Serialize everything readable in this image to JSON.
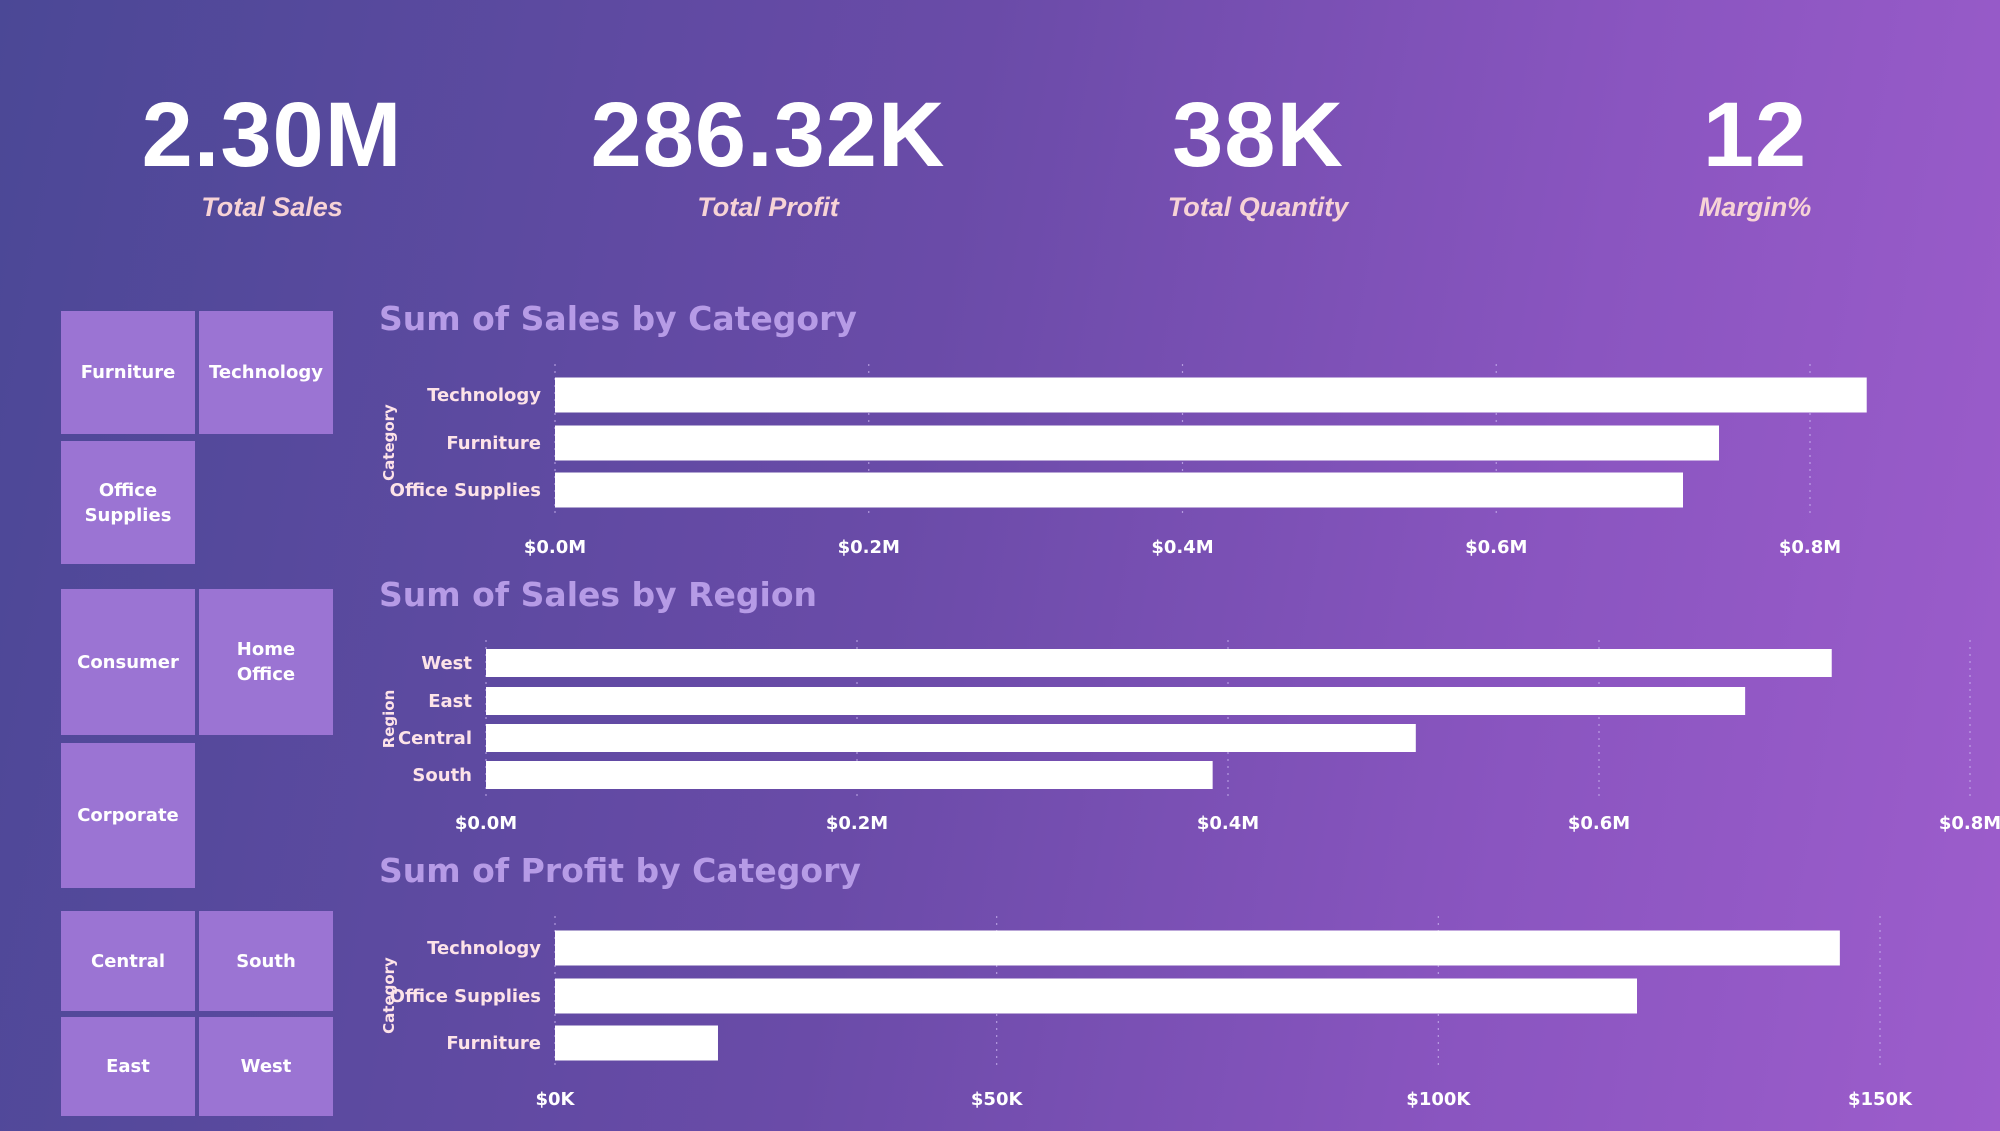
{
  "kpis": [
    {
      "value": "2.30M",
      "label": "Total Sales"
    },
    {
      "value": "286.32K",
      "label": "Total Profit"
    },
    {
      "value": "38K",
      "label": "Total Quantity"
    },
    {
      "value": "12",
      "label": "Margin%"
    }
  ],
  "slicers": {
    "category": [
      "Furniture",
      "Technology",
      "Office Supplies"
    ],
    "segment": [
      "Consumer",
      "Home Office",
      "Corporate"
    ],
    "region": [
      "Central",
      "South",
      "East",
      "West"
    ]
  },
  "colors": {
    "tile": "#9b74d3",
    "bar": "#ffffff",
    "title": "#b69be6",
    "kpi_label": "#f7d3d6"
  },
  "chart_data": [
    {
      "type": "bar",
      "orientation": "horizontal",
      "title": "Sum of Sales by Category",
      "ylabel": "Category",
      "xlabel": "",
      "categories": [
        "Technology",
        "Furniture",
        "Office Supplies"
      ],
      "values": [
        836154,
        741999,
        719047
      ],
      "xlim": [
        0,
        800000
      ],
      "ticks": [
        0,
        200000,
        400000,
        600000,
        800000
      ],
      "tick_labels": [
        "$0.0M",
        "$0.2M",
        "$0.4M",
        "$0.6M",
        "$0.8M"
      ],
      "grid": true
    },
    {
      "type": "bar",
      "orientation": "horizontal",
      "title": "Sum of Sales by Region",
      "ylabel": "Region",
      "xlabel": "",
      "categories": [
        "West",
        "East",
        "Central",
        "South"
      ],
      "values": [
        725458,
        678781,
        501240,
        391722
      ],
      "xlim": [
        0,
        800000
      ],
      "ticks": [
        0,
        200000,
        400000,
        600000,
        800000
      ],
      "tick_labels": [
        "$0.0M",
        "$0.2M",
        "$0.4M",
        "$0.6M",
        "$0.8M"
      ],
      "grid": true
    },
    {
      "type": "bar",
      "orientation": "horizontal",
      "title": "Sum of Profit by Category",
      "ylabel": "Category",
      "xlabel": "",
      "categories": [
        "Technology",
        "Office Supplies",
        "Furniture"
      ],
      "values": [
        145455,
        122491,
        18451
      ],
      "xlim": [
        0,
        150000
      ],
      "ticks": [
        0,
        50000,
        100000,
        150000
      ],
      "tick_labels": [
        "$0K",
        "$50K",
        "$100K",
        "$150K"
      ],
      "grid": true
    }
  ]
}
